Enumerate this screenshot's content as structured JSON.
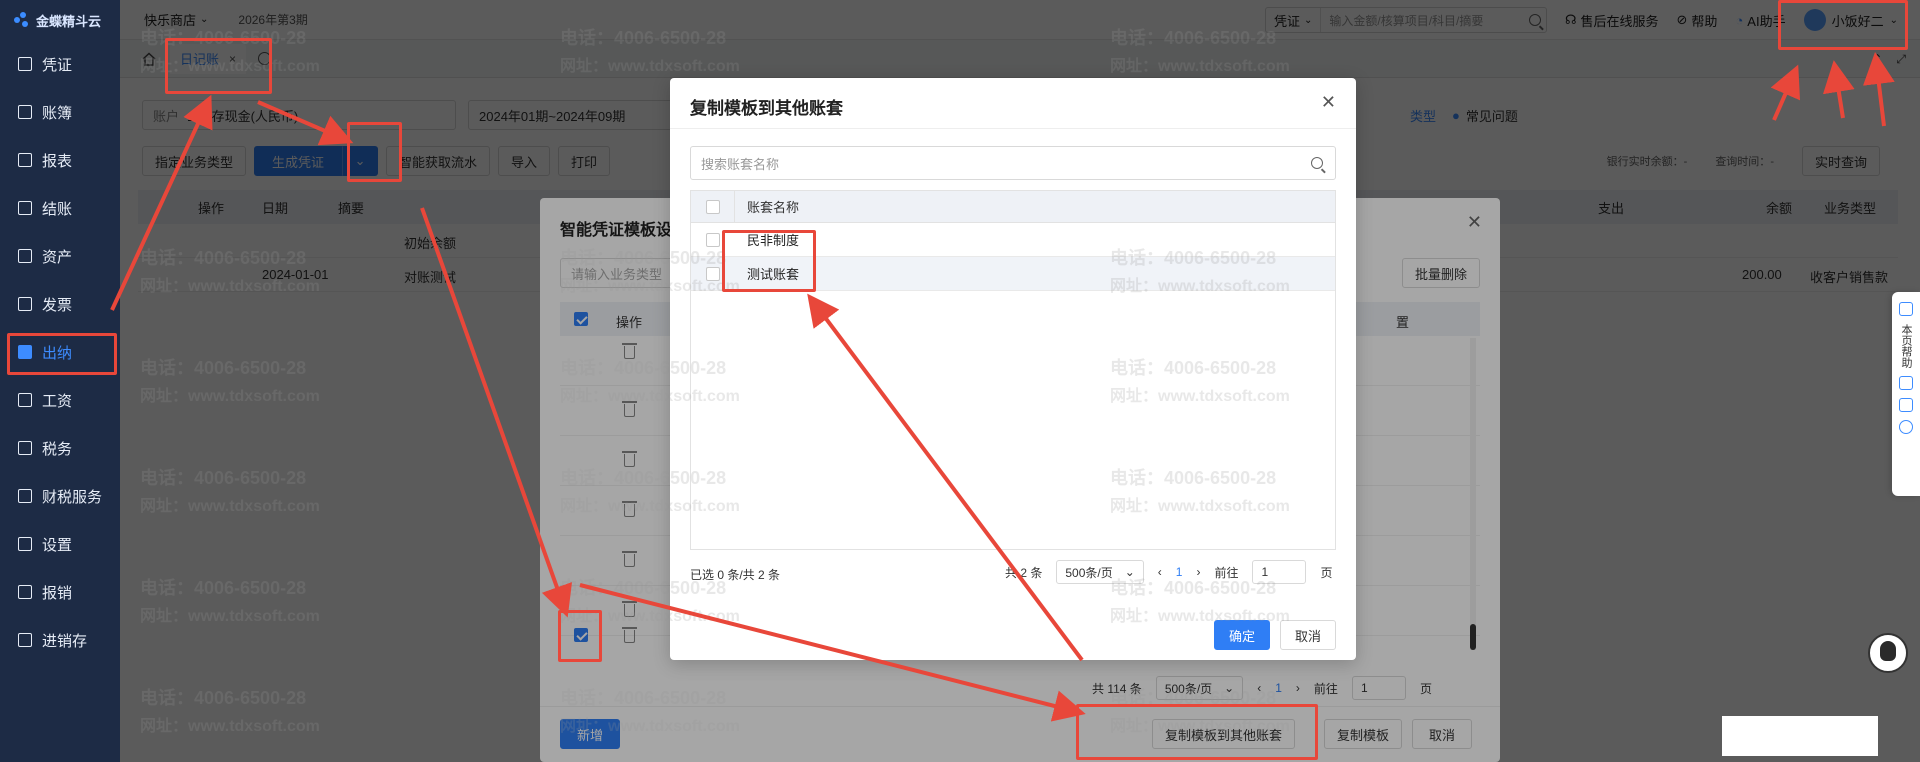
{
  "logo": {
    "text": "金蝶精斗云"
  },
  "sidebar": {
    "items": [
      {
        "label": "凭证",
        "icon": "voucher-icon"
      },
      {
        "label": "账簿",
        "icon": "ledger-icon"
      },
      {
        "label": "报表",
        "icon": "report-icon"
      },
      {
        "label": "结账",
        "icon": "closing-icon"
      },
      {
        "label": "资产",
        "icon": "asset-icon"
      },
      {
        "label": "发票",
        "icon": "invoice-icon"
      },
      {
        "label": "出纳",
        "icon": "cashier-icon",
        "active": true
      },
      {
        "label": "工资",
        "icon": "salary-icon"
      },
      {
        "label": "税务",
        "icon": "tax-icon"
      },
      {
        "label": "财税服务",
        "icon": "service-icon"
      },
      {
        "label": "设置",
        "icon": "settings-icon"
      },
      {
        "label": "报销",
        "icon": "reimburse-icon"
      },
      {
        "label": "进销存",
        "icon": "inventory-icon"
      }
    ]
  },
  "header": {
    "company": "快乐商店",
    "period": "2026年第3期",
    "search_type": "凭证",
    "search_placeholder": "输入金额/核算项目/科目/摘要",
    "after_sales": "售后在线服务",
    "help": "帮助",
    "ai": "AI助手",
    "user": "小饭好二"
  },
  "tabs": [
    {
      "label": "日记账",
      "close": "×"
    }
  ],
  "page": {
    "account_label": "账户",
    "account_value": "1-库存现金(人民币)",
    "date_range": "2024年01期~2024年09期",
    "faq": "常见问题",
    "type_link": "类型",
    "buttons": {
      "assign_type": "指定业务类型",
      "gen_voucher": "生成凭证",
      "smart_fetch": "智能获取流水",
      "import": "导入",
      "print": "打印",
      "realtime_query": "实时查询"
    },
    "bank_balance": "银行实时余额：",
    "query_time": "查询时间：",
    "dash": "-",
    "table_head": {
      "op": "操作",
      "date": "日期",
      "summary": "摘要",
      "expense": "支出",
      "balance": "余额",
      "biz_type": "业务类型"
    },
    "rows": [
      {
        "date": "",
        "summary": "初始余额",
        "balance": "",
        "biz_type": ""
      },
      {
        "date": "2024-01-01",
        "summary": "对账测试",
        "balance": "200.00",
        "biz_type": "收客户销售款"
      }
    ]
  },
  "dialog2": {
    "title": "智能凭证模板设",
    "search_placeholder": "请输入业务类型",
    "batch_delete": "批量删除",
    "col_op": "操作",
    "col_setting": "置",
    "total": "共 114 条",
    "page_size": "500条/页",
    "page_num": "1",
    "goto": "前往",
    "goto_value": "1",
    "page_unit": "页",
    "buttons": {
      "add": "新增",
      "copy_to_other": "复制模板到其他账套",
      "copy": "复制模板",
      "cancel": "取消"
    }
  },
  "dialog1": {
    "title": "复制模板到其他账套",
    "search_placeholder": "搜索账套名称",
    "col_name": "账套名称",
    "rows": [
      {
        "name": "民非制度"
      },
      {
        "name": "测试账套"
      }
    ],
    "selected_info": "已选 0 条/共 2 条",
    "total": "共 2 条",
    "page_size": "500条/页",
    "page_num": "1",
    "goto": "前往",
    "goto_value": "1",
    "page_unit": "页",
    "confirm": "确定",
    "cancel": "取消"
  },
  "helper": {
    "label": "本页帮助"
  },
  "watermark": {
    "phone": "电话：4006-6500-28",
    "site": "网址：www.tdxsoft.com"
  },
  "colors": {
    "sidebar": "#1d2b45",
    "primary": "#2f7ef5",
    "annotation": "#e8473a"
  }
}
